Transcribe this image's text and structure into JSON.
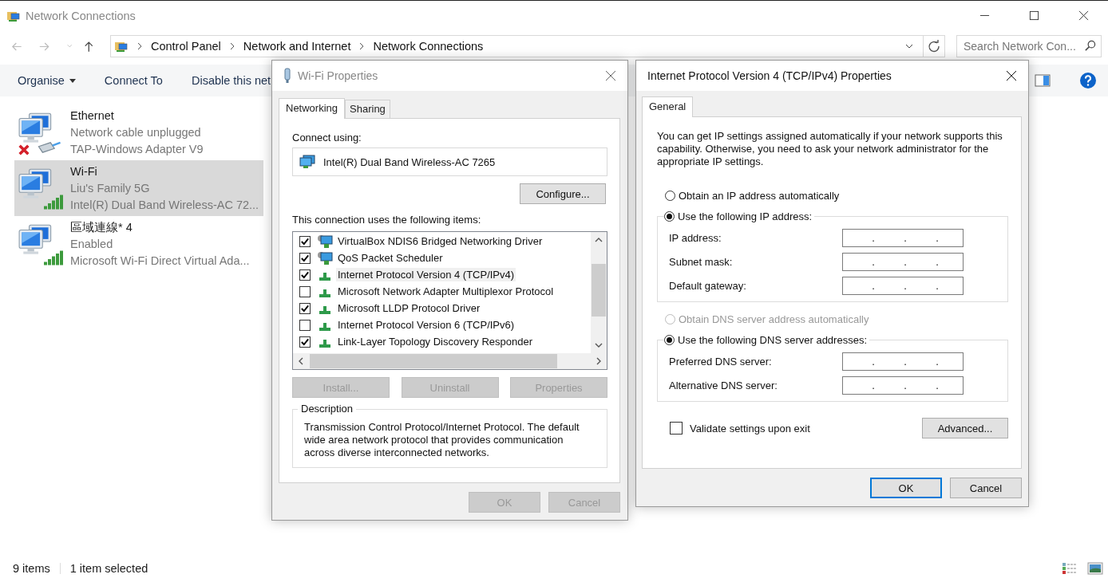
{
  "window": {
    "title": "Network Connections"
  },
  "address": {
    "crumbs": [
      "Control Panel",
      "Network and Internet",
      "Network Connections"
    ]
  },
  "search": {
    "placeholder": "Search Network Con..."
  },
  "commands": [
    {
      "label": "Organise",
      "dropdown": true
    },
    {
      "label": "Connect To",
      "dropdown": false
    },
    {
      "label": "Disable this net",
      "dropdown": false
    }
  ],
  "connections": [
    {
      "name": "Ethernet",
      "status": "Network cable unplugged",
      "adapter": "TAP-Windows Adapter V9",
      "kind": "ethernet",
      "selected": false
    },
    {
      "name": "Wi-Fi",
      "status": "Liu's Family 5G",
      "adapter": "Intel(R) Dual Band Wireless-AC 72...",
      "kind": "wifi",
      "selected": true
    },
    {
      "name": "區域連線* 4",
      "status": "Enabled",
      "adapter": "Microsoft Wi-Fi Direct Virtual Ada...",
      "kind": "wifi",
      "selected": false
    }
  ],
  "status_bar": {
    "count": "9 items",
    "selection": "1 item selected"
  },
  "wifi_dialog": {
    "title": "Wi-Fi Properties",
    "tabs": [
      {
        "label": "Networking",
        "selected": true
      },
      {
        "label": "Sharing",
        "selected": false
      }
    ],
    "connect_label": "Connect using:",
    "adapter": "Intel(R) Dual Band Wireless-AC 7265",
    "configure": "Configure...",
    "items_label": "This connection uses the following items:",
    "items": [
      {
        "label": "VirtualBox NDIS6 Bridged Networking Driver",
        "checked": true,
        "selected": false,
        "kind": "service"
      },
      {
        "label": "QoS Packet Scheduler",
        "checked": true,
        "selected": false,
        "kind": "service"
      },
      {
        "label": "Internet Protocol Version 4 (TCP/IPv4)",
        "checked": true,
        "selected": true,
        "kind": "protocol"
      },
      {
        "label": "Microsoft Network Adapter Multiplexor Protocol",
        "checked": false,
        "selected": false,
        "kind": "protocol"
      },
      {
        "label": "Microsoft LLDP Protocol Driver",
        "checked": true,
        "selected": false,
        "kind": "protocol"
      },
      {
        "label": "Internet Protocol Version 6 (TCP/IPv6)",
        "checked": false,
        "selected": false,
        "kind": "protocol"
      },
      {
        "label": "Link-Layer Topology Discovery Responder",
        "checked": true,
        "selected": false,
        "kind": "protocol"
      }
    ],
    "item_buttons": [
      {
        "label": "Install...",
        "disabled": true
      },
      {
        "label": "Uninstall",
        "disabled": true
      },
      {
        "label": "Properties",
        "disabled": true
      }
    ],
    "description_label": "Description",
    "description": "Transmission Control Protocol/Internet Protocol. The default wide area network protocol that provides communication across diverse interconnected networks.",
    "footer_buttons": [
      {
        "label": "OK",
        "disabled": true
      },
      {
        "label": "Cancel",
        "disabled": true
      }
    ]
  },
  "ipv4_dialog": {
    "title": "Internet Protocol Version 4 (TCP/IPv4) Properties",
    "tabs": [
      {
        "label": "General",
        "selected": true
      }
    ],
    "intro": "You can get IP settings assigned automatically if your network supports this capability. Otherwise, you need to ask your network administrator for the appropriate IP settings.",
    "ip_auto": {
      "label": "Obtain an IP address automatically",
      "selected": false,
      "disabled": false
    },
    "ip_manual": {
      "label": "Use the following IP address:",
      "selected": true,
      "disabled": false
    },
    "ip_fields": [
      {
        "label": "IP address:",
        "dots": [
          ".",
          ".",
          "."
        ]
      },
      {
        "label": "Subnet mask:",
        "dots": [
          ".",
          ".",
          "."
        ]
      },
      {
        "label": "Default gateway:",
        "dots": [
          ".",
          ".",
          "."
        ]
      }
    ],
    "dns_auto": {
      "label": "Obtain DNS server address automatically",
      "selected": false,
      "disabled": true
    },
    "dns_manual": {
      "label": "Use the following DNS server addresses:",
      "selected": true,
      "disabled": false
    },
    "dns_fields": [
      {
        "label": "Preferred DNS server:",
        "dots": [
          ".",
          ".",
          "."
        ]
      },
      {
        "label": "Alternative DNS server:",
        "dots": [
          ".",
          ".",
          "."
        ]
      }
    ],
    "validate": {
      "label": "Validate settings upon exit",
      "checked": false
    },
    "advanced": "Advanced...",
    "footer_buttons": [
      {
        "label": "OK",
        "default": true
      },
      {
        "label": "Cancel",
        "default": false
      }
    ]
  }
}
